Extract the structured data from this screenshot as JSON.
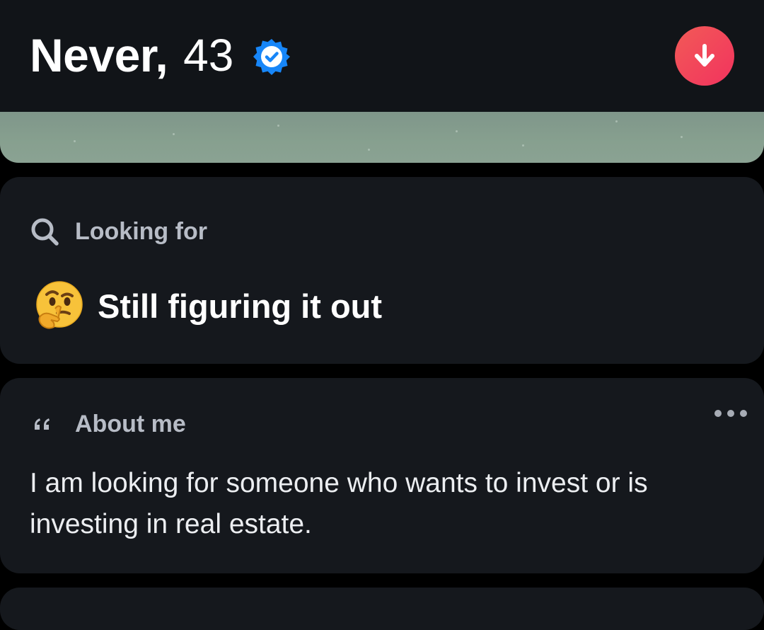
{
  "profile": {
    "name": "Never,",
    "age": "43",
    "verified_icon": "verified-badge-icon",
    "collapse_icon": "arrow-down-icon"
  },
  "looking_for": {
    "label": "Looking for",
    "icon": "search-icon",
    "emoji_icon": "thinking-face-emoji",
    "value": "Still figuring it out"
  },
  "about": {
    "label": "About me",
    "icon": "quote-icon",
    "more_icon": "more-dots-icon",
    "text": "I am looking for someone who wants to invest or is investing in real estate."
  },
  "colors": {
    "background": "#000000",
    "card": "#15181d",
    "header": "#111418",
    "accent_gradient_start": "#f25a57",
    "accent_gradient_end": "#f2335e",
    "verified_blue": "#1786f8",
    "label_gray": "#b7bcc6"
  }
}
